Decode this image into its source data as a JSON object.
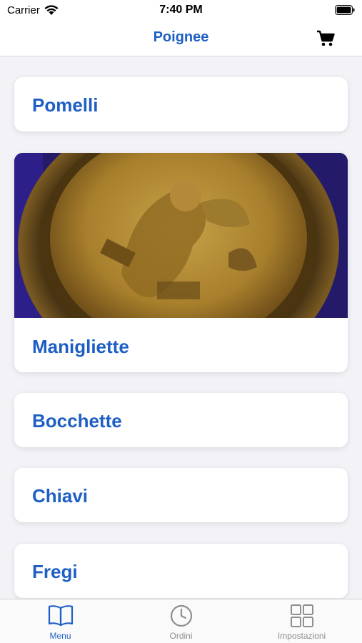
{
  "status_bar": {
    "carrier": "Carrier",
    "time": "7:40 PM"
  },
  "nav": {
    "title": "Poignee",
    "cart_icon": "cart-icon"
  },
  "colors": {
    "accent": "#1d5fc4",
    "inactive": "#8e8e93"
  },
  "categories": [
    {
      "label": "Pomelli"
    },
    {
      "label": "Manigliette"
    },
    {
      "label": "Bocchette"
    },
    {
      "label": "Chiavi"
    },
    {
      "label": "Fregi"
    }
  ],
  "tabs": [
    {
      "label": "Menu",
      "icon": "book-icon",
      "active": true
    },
    {
      "label": "Ordini",
      "icon": "clock-icon",
      "active": false
    },
    {
      "label": "Impostazioni",
      "icon": "grid-icon",
      "active": false
    }
  ]
}
